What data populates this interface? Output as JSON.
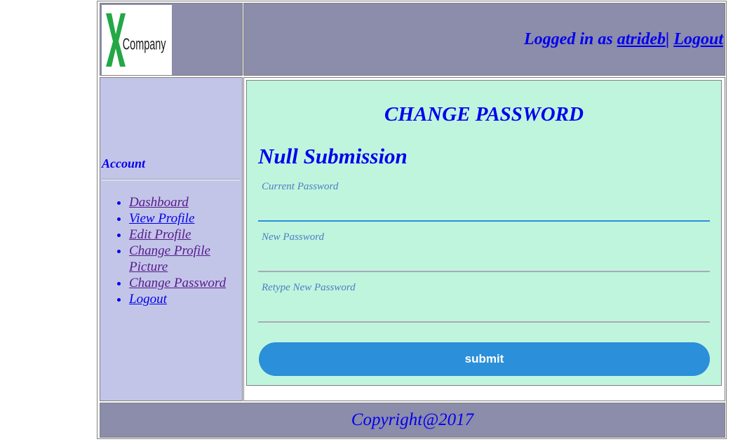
{
  "header": {
    "logo_letter": "X",
    "logo_text": "Company",
    "logged_in_prefix": "Logged in as ",
    "username": "atrideb",
    "separator": "|",
    "logout_label": "Logout"
  },
  "sidebar": {
    "title": "Account",
    "items": [
      {
        "label": "Dashboard"
      },
      {
        "label": "View Profile"
      },
      {
        "label": "Edit Profile"
      },
      {
        "label": "Change Profile Picture"
      },
      {
        "label": "Change Password"
      },
      {
        "label": "Logout"
      }
    ]
  },
  "form": {
    "title": "CHANGE PASSWORD",
    "error_message": "Null Submission",
    "current_password_label": "Current Password",
    "current_password_value": "",
    "new_password_label": "New Password",
    "new_password_value": "",
    "retype_password_label": "Retype New Password",
    "retype_password_value": "",
    "submit_label": "submit"
  },
  "footer": {
    "copyright": "Copyright@2017"
  },
  "colors": {
    "header_bg": "#8c8cab",
    "sidebar_bg": "#c3c5e8",
    "panel_bg": "#c0f5dd",
    "link": "#0000ee",
    "submit_bg": "#2b8fd9",
    "logo_green": "#22a845"
  }
}
